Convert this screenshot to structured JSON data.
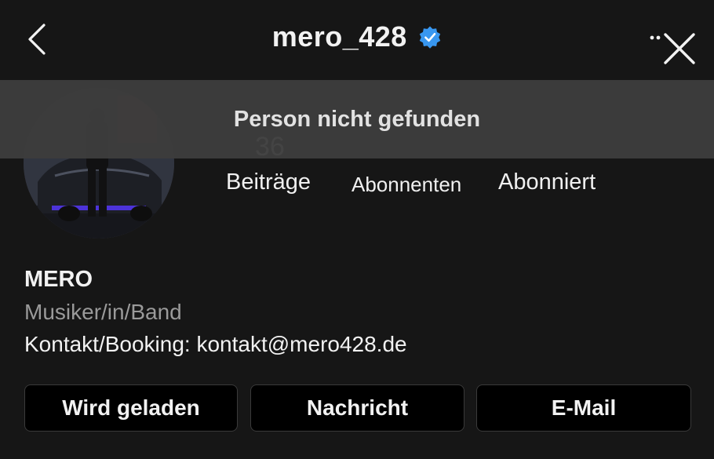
{
  "header": {
    "username": "mero_428",
    "back_icon": "chevron-left-icon",
    "verified_icon": "verified-badge-icon",
    "verified_color": "#3897f0",
    "more_icon": "more-dots-icon",
    "close_icon": "close-icon"
  },
  "toast": {
    "message": "Person nicht gefunden"
  },
  "stats": {
    "posts_count": "36",
    "posts_label": "Beiträge",
    "followers_label": "Abonnenten",
    "following_label": "Abonniert"
  },
  "bio": {
    "name": "MERO",
    "category": "Musiker/in/Band",
    "contact": "Kontakt/Booking: kontakt@mero428.de"
  },
  "actions": {
    "loading_label": "Wird geladen",
    "message_label": "Nachricht",
    "email_label": "E-Mail"
  }
}
